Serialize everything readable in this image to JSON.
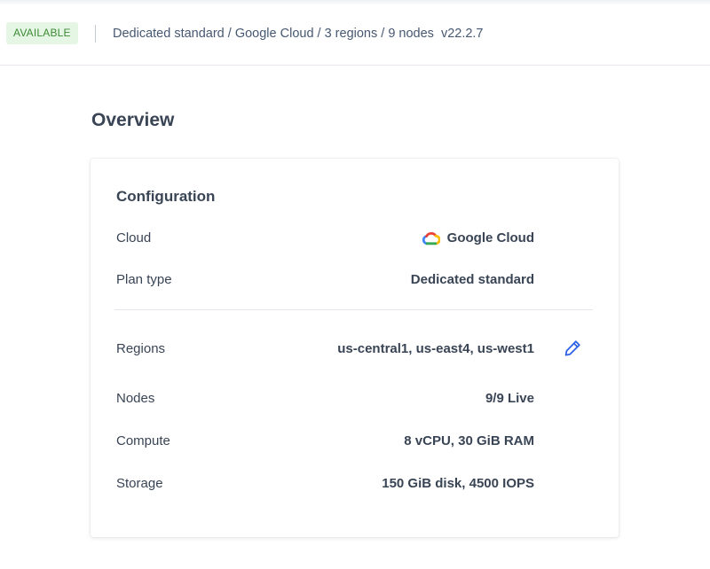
{
  "status_bar": {
    "badge": "AVAILABLE",
    "summary": "Dedicated standard / Google Cloud / 3 regions / 9 nodes",
    "version": "v22.2.7"
  },
  "page_title": "Overview",
  "card": {
    "title": "Configuration",
    "rows": [
      {
        "label": "Cloud",
        "value": "Google Cloud",
        "icon": "google-cloud-icon"
      },
      {
        "label": "Plan type",
        "value": "Dedicated standard"
      },
      {
        "label": "Regions",
        "value": "us-central1, us-east4, us-west1",
        "action_icon": "pencil-edit-icon"
      },
      {
        "label": "Nodes",
        "value": "9/9 Live"
      },
      {
        "label": "Compute",
        "value": "8 vCPU, 30 GiB RAM"
      },
      {
        "label": "Storage",
        "value": "150 GiB disk, 4500 IOPS"
      }
    ]
  },
  "colors": {
    "badge_bg": "#e6f6e4",
    "badge_text": "#3c8b35",
    "text": "#394455",
    "edit_icon": "#2f63e6"
  }
}
